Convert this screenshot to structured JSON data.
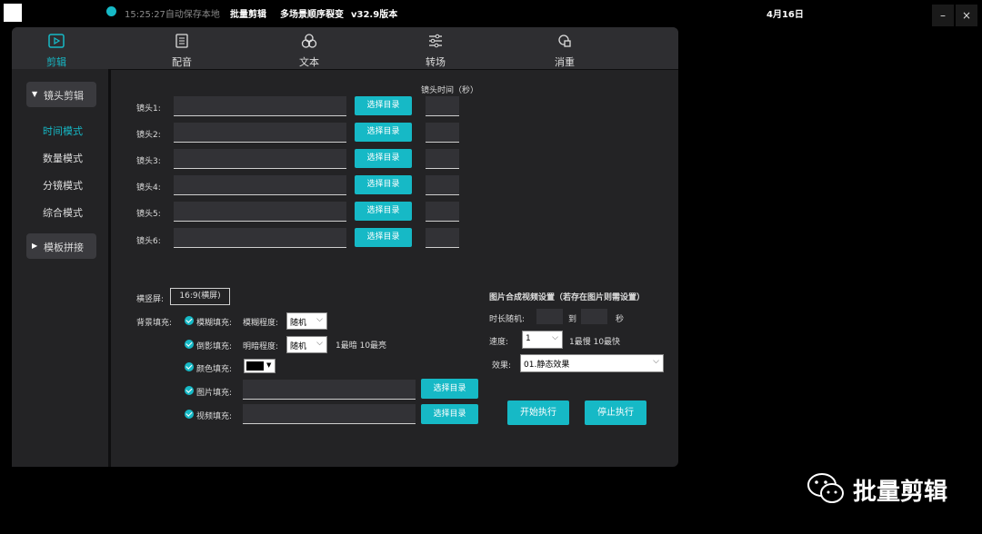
{
  "titlebar": {
    "save_status": "15:25:27自动保存本地",
    "app_name": "批量剪辑",
    "feature_name": "多场景顺序裂变",
    "version": "v32.9版本",
    "date": "4月16日",
    "minimize": "–",
    "close": "×"
  },
  "nav": {
    "tabs": [
      {
        "label": "剪辑",
        "icon": "play-square-icon"
      },
      {
        "label": "配音",
        "icon": "document-icon"
      },
      {
        "label": "文本",
        "icon": "circles-icon"
      },
      {
        "label": "转场",
        "icon": "sliders-icon"
      },
      {
        "label": "消重",
        "icon": "shape-icon"
      }
    ],
    "active_index": 0
  },
  "sidebar": {
    "section1": "镜头剪辑",
    "items": [
      "时间模式",
      "数量模式",
      "分镜模式",
      "综合模式"
    ],
    "active_index": 0,
    "section2": "模板拼接"
  },
  "shots": {
    "time_header": "镜头时间（秒）",
    "button_label": "选择目录",
    "rows": [
      {
        "label": "镜头1:",
        "path": "",
        "time": ""
      },
      {
        "label": "镜头2:",
        "path": "",
        "time": ""
      },
      {
        "label": "镜头3:",
        "path": "",
        "time": ""
      },
      {
        "label": "镜头4:",
        "path": "",
        "time": ""
      },
      {
        "label": "镜头5:",
        "path": "",
        "time": ""
      },
      {
        "label": "镜头6:",
        "path": "",
        "time": ""
      }
    ]
  },
  "screen": {
    "label": "横竖屏:",
    "value": "16:9(横屏)"
  },
  "background": {
    "label": "背景填充:",
    "blur": {
      "label": "模糊填充:",
      "degree_label": "模糊程度:",
      "value": "随机"
    },
    "reflect": {
      "label": "倒影填充:",
      "brightness_label": "明暗程度:",
      "value": "随机",
      "hint": "1最暗 10最亮"
    },
    "color": {
      "label": "颜色填充:",
      "swatch": "#000000"
    },
    "image": {
      "label": "图片填充:",
      "path": "",
      "button": "选择目录"
    },
    "video": {
      "label": "视频填充:",
      "path": "",
      "button": "选择目录"
    }
  },
  "image_video": {
    "title": "图片合成视频设置（若存在图片则需设置）",
    "duration_label": "时长随机:",
    "to_label": "到",
    "sec_label": "秒",
    "duration_from": "",
    "duration_to": "",
    "speed_label": "速度:",
    "speed_value": "1",
    "speed_hint": "1最慢 10最快",
    "effect_label": "效果:",
    "effect_value": "01.静态效果"
  },
  "actions": {
    "start": "开始执行",
    "stop": "停止执行"
  },
  "watermark": {
    "text": "批量剪辑"
  },
  "colors": {
    "accent": "#16b9c6",
    "window_bg": "#232325",
    "nav_bg": "#2e2e31"
  }
}
